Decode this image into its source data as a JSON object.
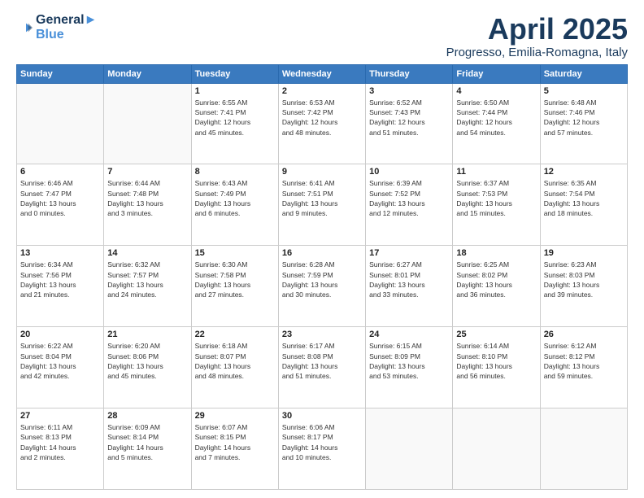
{
  "header": {
    "logo_line1": "General",
    "logo_line2": "Blue",
    "month": "April 2025",
    "location": "Progresso, Emilia-Romagna, Italy"
  },
  "weekdays": [
    "Sunday",
    "Monday",
    "Tuesday",
    "Wednesday",
    "Thursday",
    "Friday",
    "Saturday"
  ],
  "weeks": [
    [
      {
        "day": "",
        "info": ""
      },
      {
        "day": "",
        "info": ""
      },
      {
        "day": "1",
        "info": "Sunrise: 6:55 AM\nSunset: 7:41 PM\nDaylight: 12 hours\nand 45 minutes."
      },
      {
        "day": "2",
        "info": "Sunrise: 6:53 AM\nSunset: 7:42 PM\nDaylight: 12 hours\nand 48 minutes."
      },
      {
        "day": "3",
        "info": "Sunrise: 6:52 AM\nSunset: 7:43 PM\nDaylight: 12 hours\nand 51 minutes."
      },
      {
        "day": "4",
        "info": "Sunrise: 6:50 AM\nSunset: 7:44 PM\nDaylight: 12 hours\nand 54 minutes."
      },
      {
        "day": "5",
        "info": "Sunrise: 6:48 AM\nSunset: 7:46 PM\nDaylight: 12 hours\nand 57 minutes."
      }
    ],
    [
      {
        "day": "6",
        "info": "Sunrise: 6:46 AM\nSunset: 7:47 PM\nDaylight: 13 hours\nand 0 minutes."
      },
      {
        "day": "7",
        "info": "Sunrise: 6:44 AM\nSunset: 7:48 PM\nDaylight: 13 hours\nand 3 minutes."
      },
      {
        "day": "8",
        "info": "Sunrise: 6:43 AM\nSunset: 7:49 PM\nDaylight: 13 hours\nand 6 minutes."
      },
      {
        "day": "9",
        "info": "Sunrise: 6:41 AM\nSunset: 7:51 PM\nDaylight: 13 hours\nand 9 minutes."
      },
      {
        "day": "10",
        "info": "Sunrise: 6:39 AM\nSunset: 7:52 PM\nDaylight: 13 hours\nand 12 minutes."
      },
      {
        "day": "11",
        "info": "Sunrise: 6:37 AM\nSunset: 7:53 PM\nDaylight: 13 hours\nand 15 minutes."
      },
      {
        "day": "12",
        "info": "Sunrise: 6:35 AM\nSunset: 7:54 PM\nDaylight: 13 hours\nand 18 minutes."
      }
    ],
    [
      {
        "day": "13",
        "info": "Sunrise: 6:34 AM\nSunset: 7:56 PM\nDaylight: 13 hours\nand 21 minutes."
      },
      {
        "day": "14",
        "info": "Sunrise: 6:32 AM\nSunset: 7:57 PM\nDaylight: 13 hours\nand 24 minutes."
      },
      {
        "day": "15",
        "info": "Sunrise: 6:30 AM\nSunset: 7:58 PM\nDaylight: 13 hours\nand 27 minutes."
      },
      {
        "day": "16",
        "info": "Sunrise: 6:28 AM\nSunset: 7:59 PM\nDaylight: 13 hours\nand 30 minutes."
      },
      {
        "day": "17",
        "info": "Sunrise: 6:27 AM\nSunset: 8:01 PM\nDaylight: 13 hours\nand 33 minutes."
      },
      {
        "day": "18",
        "info": "Sunrise: 6:25 AM\nSunset: 8:02 PM\nDaylight: 13 hours\nand 36 minutes."
      },
      {
        "day": "19",
        "info": "Sunrise: 6:23 AM\nSunset: 8:03 PM\nDaylight: 13 hours\nand 39 minutes."
      }
    ],
    [
      {
        "day": "20",
        "info": "Sunrise: 6:22 AM\nSunset: 8:04 PM\nDaylight: 13 hours\nand 42 minutes."
      },
      {
        "day": "21",
        "info": "Sunrise: 6:20 AM\nSunset: 8:06 PM\nDaylight: 13 hours\nand 45 minutes."
      },
      {
        "day": "22",
        "info": "Sunrise: 6:18 AM\nSunset: 8:07 PM\nDaylight: 13 hours\nand 48 minutes."
      },
      {
        "day": "23",
        "info": "Sunrise: 6:17 AM\nSunset: 8:08 PM\nDaylight: 13 hours\nand 51 minutes."
      },
      {
        "day": "24",
        "info": "Sunrise: 6:15 AM\nSunset: 8:09 PM\nDaylight: 13 hours\nand 53 minutes."
      },
      {
        "day": "25",
        "info": "Sunrise: 6:14 AM\nSunset: 8:10 PM\nDaylight: 13 hours\nand 56 minutes."
      },
      {
        "day": "26",
        "info": "Sunrise: 6:12 AM\nSunset: 8:12 PM\nDaylight: 13 hours\nand 59 minutes."
      }
    ],
    [
      {
        "day": "27",
        "info": "Sunrise: 6:11 AM\nSunset: 8:13 PM\nDaylight: 14 hours\nand 2 minutes."
      },
      {
        "day": "28",
        "info": "Sunrise: 6:09 AM\nSunset: 8:14 PM\nDaylight: 14 hours\nand 5 minutes."
      },
      {
        "day": "29",
        "info": "Sunrise: 6:07 AM\nSunset: 8:15 PM\nDaylight: 14 hours\nand 7 minutes."
      },
      {
        "day": "30",
        "info": "Sunrise: 6:06 AM\nSunset: 8:17 PM\nDaylight: 14 hours\nand 10 minutes."
      },
      {
        "day": "",
        "info": ""
      },
      {
        "day": "",
        "info": ""
      },
      {
        "day": "",
        "info": ""
      }
    ]
  ]
}
